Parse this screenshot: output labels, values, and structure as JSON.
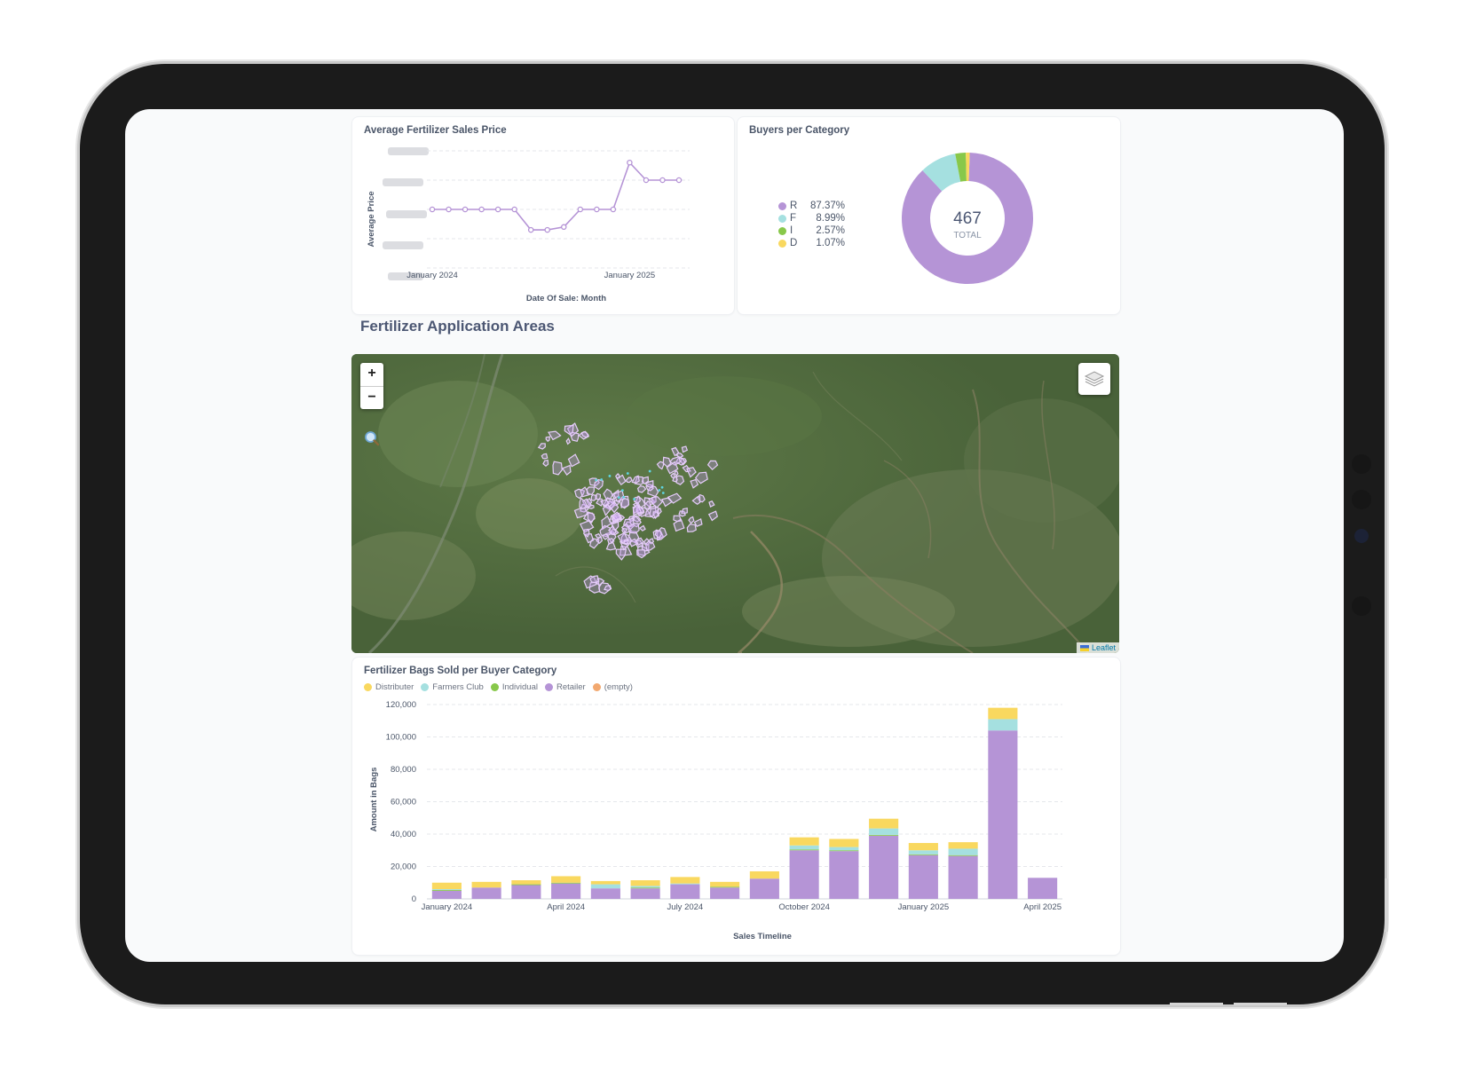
{
  "colors": {
    "retailer": "#b594d6",
    "farmers_club": "#a5e0e0",
    "individual": "#88c84a",
    "distributer": "#f9d85f",
    "empty": "#f2a86f",
    "line": "#b594d6",
    "field_outline": "#e6cdfa"
  },
  "price_card": {
    "title": "Average Fertilizer Sales Price",
    "ylabel": "Average Price",
    "xlabel": "Date Of Sale: Month",
    "x_ticks": [
      "January 2024",
      "January 2025"
    ]
  },
  "buyers_card": {
    "title": "Buyers per Category",
    "total_value": "467",
    "total_label": "TOTAL",
    "legend": [
      {
        "key": "R",
        "pct": "87.37%"
      },
      {
        "key": "F",
        "pct": "8.99%"
      },
      {
        "key": "I",
        "pct": "2.57%"
      },
      {
        "key": "D",
        "pct": "1.07%"
      }
    ]
  },
  "map_section": {
    "title": "Fertilizer Application Areas",
    "zoom_in": "+",
    "zoom_out": "−",
    "attribution": "Leaflet"
  },
  "bags_card": {
    "title": "Fertilizer Bags Sold per Buyer Category",
    "legend": [
      "Distributer",
      "Farmers Club",
      "Individual",
      "Retailer",
      "(empty)"
    ]
  },
  "chart_data": [
    {
      "type": "line",
      "title": "Average Fertilizer Sales Price",
      "xlabel": "Date Of Sale: Month",
      "ylabel": "Average Price",
      "x_tick_labels": [
        "January 2024",
        "January 2025"
      ],
      "y_tick_labels_obscured": true,
      "series": [
        {
          "values": [
            3,
            3,
            3,
            3,
            3,
            3,
            2.3,
            2.3,
            2.4,
            3,
            3,
            3,
            4.6,
            4,
            4,
            4
          ]
        }
      ],
      "ylim": [
        1,
        5
      ]
    },
    {
      "type": "pie",
      "donut": true,
      "title": "Buyers per Category",
      "center_value": "467",
      "center_label": "TOTAL",
      "labels": [
        "R",
        "F",
        "I",
        "D"
      ],
      "values": [
        87.37,
        8.99,
        2.57,
        1.07
      ]
    },
    {
      "type": "bar",
      "stacked": true,
      "title": "Fertilizer Bags Sold per Buyer Category",
      "xlabel": "Sales Timeline",
      "ylabel": "Amount in Bags",
      "ylim": [
        0,
        120000
      ],
      "y_ticks": [
        "0",
        "20,000",
        "40,000",
        "60,000",
        "80,000",
        "100,000",
        "120,000"
      ],
      "x_tick_labels": [
        {
          "index": 0,
          "label": "January 2024"
        },
        {
          "index": 3,
          "label": "April 2024"
        },
        {
          "index": 6,
          "label": "July 2024"
        },
        {
          "index": 9,
          "label": "October 2024"
        },
        {
          "index": 12,
          "label": "January 2025"
        },
        {
          "index": 15,
          "label": "April 2025"
        }
      ],
      "categories": [
        "Jan 2024",
        "Feb 2024",
        "Mar 2024",
        "Apr 2024",
        "May 2024",
        "Jun 2024",
        "Jul 2024",
        "Aug 2024",
        "Sep 2024",
        "Oct 2024",
        "Nov 2024",
        "Dec 2024",
        "Jan 2025",
        "Feb 2025",
        "Mar 2025",
        "Apr 2025"
      ],
      "series": [
        {
          "name": "Retailer",
          "values": [
            5000,
            7000,
            8500,
            9500,
            6500,
            6500,
            9000,
            7000,
            12500,
            30000,
            29500,
            39000,
            27000,
            26500,
            104000,
            13000
          ]
        },
        {
          "name": "Individual",
          "values": [
            500,
            0,
            500,
            500,
            0,
            500,
            0,
            500,
            0,
            500,
            500,
            500,
            500,
            500,
            0,
            0
          ]
        },
        {
          "name": "Farmers Club",
          "values": [
            500,
            0,
            0,
            0,
            2500,
            1000,
            500,
            0,
            0,
            2500,
            2000,
            4000,
            2500,
            4000,
            7000,
            0
          ]
        },
        {
          "name": "Distributer",
          "values": [
            4000,
            3500,
            2500,
            4000,
            2000,
            3500,
            4000,
            3000,
            4500,
            5000,
            5000,
            6000,
            4500,
            4000,
            7000,
            0
          ]
        },
        {
          "name": "(empty)",
          "values": [
            0,
            0,
            0,
            0,
            0,
            0,
            0,
            0,
            0,
            0,
            0,
            0,
            0,
            0,
            0,
            0
          ]
        }
      ]
    }
  ]
}
